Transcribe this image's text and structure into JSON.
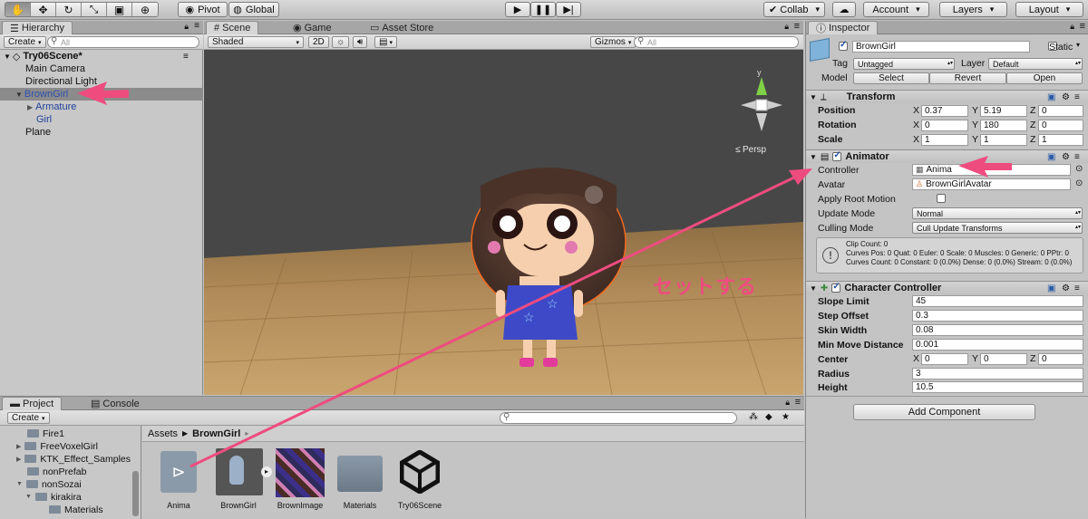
{
  "toolbar": {
    "pivot": "Pivot",
    "global": "Global",
    "collab": "Collab",
    "account": "Account",
    "layers": "Layers",
    "layout": "Layout"
  },
  "hierarchy": {
    "tab": "Hierarchy",
    "create": "Create",
    "search_placeholder": "All",
    "scene": "Try06Scene*",
    "items": [
      "Main Camera",
      "Directional Light",
      "BrownGirl",
      "Armature",
      "Girl",
      "Plane"
    ]
  },
  "scene_view": {
    "tabs": [
      "Scene",
      "Game",
      "Asset Store"
    ],
    "shading": "Shaded",
    "mode2d": "2D",
    "gizmos": "Gizmos",
    "search_placeholder": "All",
    "persp": "Persp"
  },
  "annotation": {
    "text": "セットする",
    "color": "#ee4c7f"
  },
  "inspector": {
    "tab": "Inspector",
    "object_name": "BrownGirl",
    "static": "Static",
    "tag_label": "Tag",
    "tag_value": "Untagged",
    "layer_label": "Layer",
    "layer_value": "Default",
    "model_label": "Model",
    "model_buttons": [
      "Select",
      "Revert",
      "Open"
    ],
    "transform": {
      "title": "Transform",
      "rows": [
        {
          "label": "Position",
          "x": "0.37",
          "y": "5.19",
          "z": "0"
        },
        {
          "label": "Rotation",
          "x": "0",
          "y": "180",
          "z": "0"
        },
        {
          "label": "Scale",
          "x": "1",
          "y": "1",
          "z": "1"
        }
      ]
    },
    "animator": {
      "title": "Animator",
      "controller_label": "Controller",
      "controller_value": "Anima",
      "avatar_label": "Avatar",
      "avatar_value": "BrownGirlAvatar",
      "root_motion_label": "Apply Root Motion",
      "update_mode_label": "Update Mode",
      "update_mode_value": "Normal",
      "culling_label": "Culling Mode",
      "culling_value": "Cull Update Transforms",
      "info": [
        "Clip Count: 0",
        "Curves Pos: 0 Quat: 0 Euler: 0 Scale: 0 Muscles: 0 Generic: 0 PPtr: 0",
        "Curves Count: 0 Constant: 0 (0.0%) Dense: 0 (0.0%) Stream: 0 (0.0%)"
      ]
    },
    "character_controller": {
      "title": "Character Controller",
      "slope_label": "Slope Limit",
      "slope": "45",
      "step_label": "Step Offset",
      "step": "0.3",
      "skin_label": "Skin Width",
      "skin": "0.08",
      "minmove_label": "Min Move Distance",
      "minmove": "0.001",
      "center_label": "Center",
      "center": {
        "x": "0",
        "y": "0",
        "z": "0"
      },
      "radius_label": "Radius",
      "radius": "3",
      "height_label": "Height",
      "height": "10.5"
    },
    "add_component": "Add Component"
  },
  "project": {
    "tabs": [
      "Project",
      "Console"
    ],
    "create": "Create",
    "breadcrumb": [
      "Assets",
      "BrownGirl"
    ],
    "folders": [
      "Fire1",
      "FreeVoxelGirl",
      "KTK_Effect_Samples",
      "nonPrefab",
      "nonSozai",
      "kirakira",
      "Materials"
    ],
    "assets": [
      "Anima",
      "BrownGirl",
      "BrownImage",
      "Materials",
      "Try06Scene"
    ]
  },
  "colors": {
    "accent_arrow": "#ee4c7f",
    "selection": "#8b8b8b"
  }
}
